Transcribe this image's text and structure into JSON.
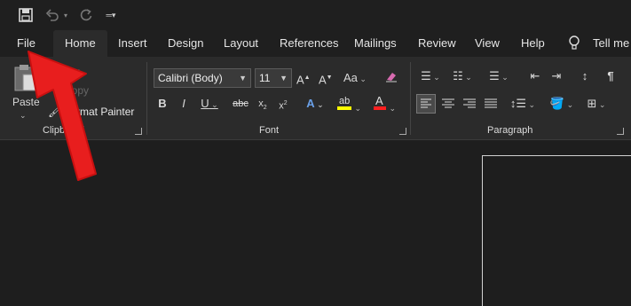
{
  "tabs": {
    "file": "File",
    "home": "Home",
    "insert": "Insert",
    "design": "Design",
    "layout": "Layout",
    "references": "References",
    "mailings": "Mailings",
    "review": "Review",
    "view": "View",
    "help": "Help",
    "tell_me": "Tell me v"
  },
  "clipboard": {
    "paste_label": "Paste",
    "cut_label": "Cut",
    "copy_label": "Copy",
    "format_painter_label": "Format Painter",
    "group_label": "Clipboard"
  },
  "font": {
    "family_value": "Calibri (Body)",
    "size_value": "11",
    "group_label": "Font"
  },
  "paragraph": {
    "group_label": "Paragraph"
  },
  "colors": {
    "accent_red": "#e81e1e",
    "highlight_yellow": "#ffff00",
    "font_color_red": "#ff2020"
  }
}
